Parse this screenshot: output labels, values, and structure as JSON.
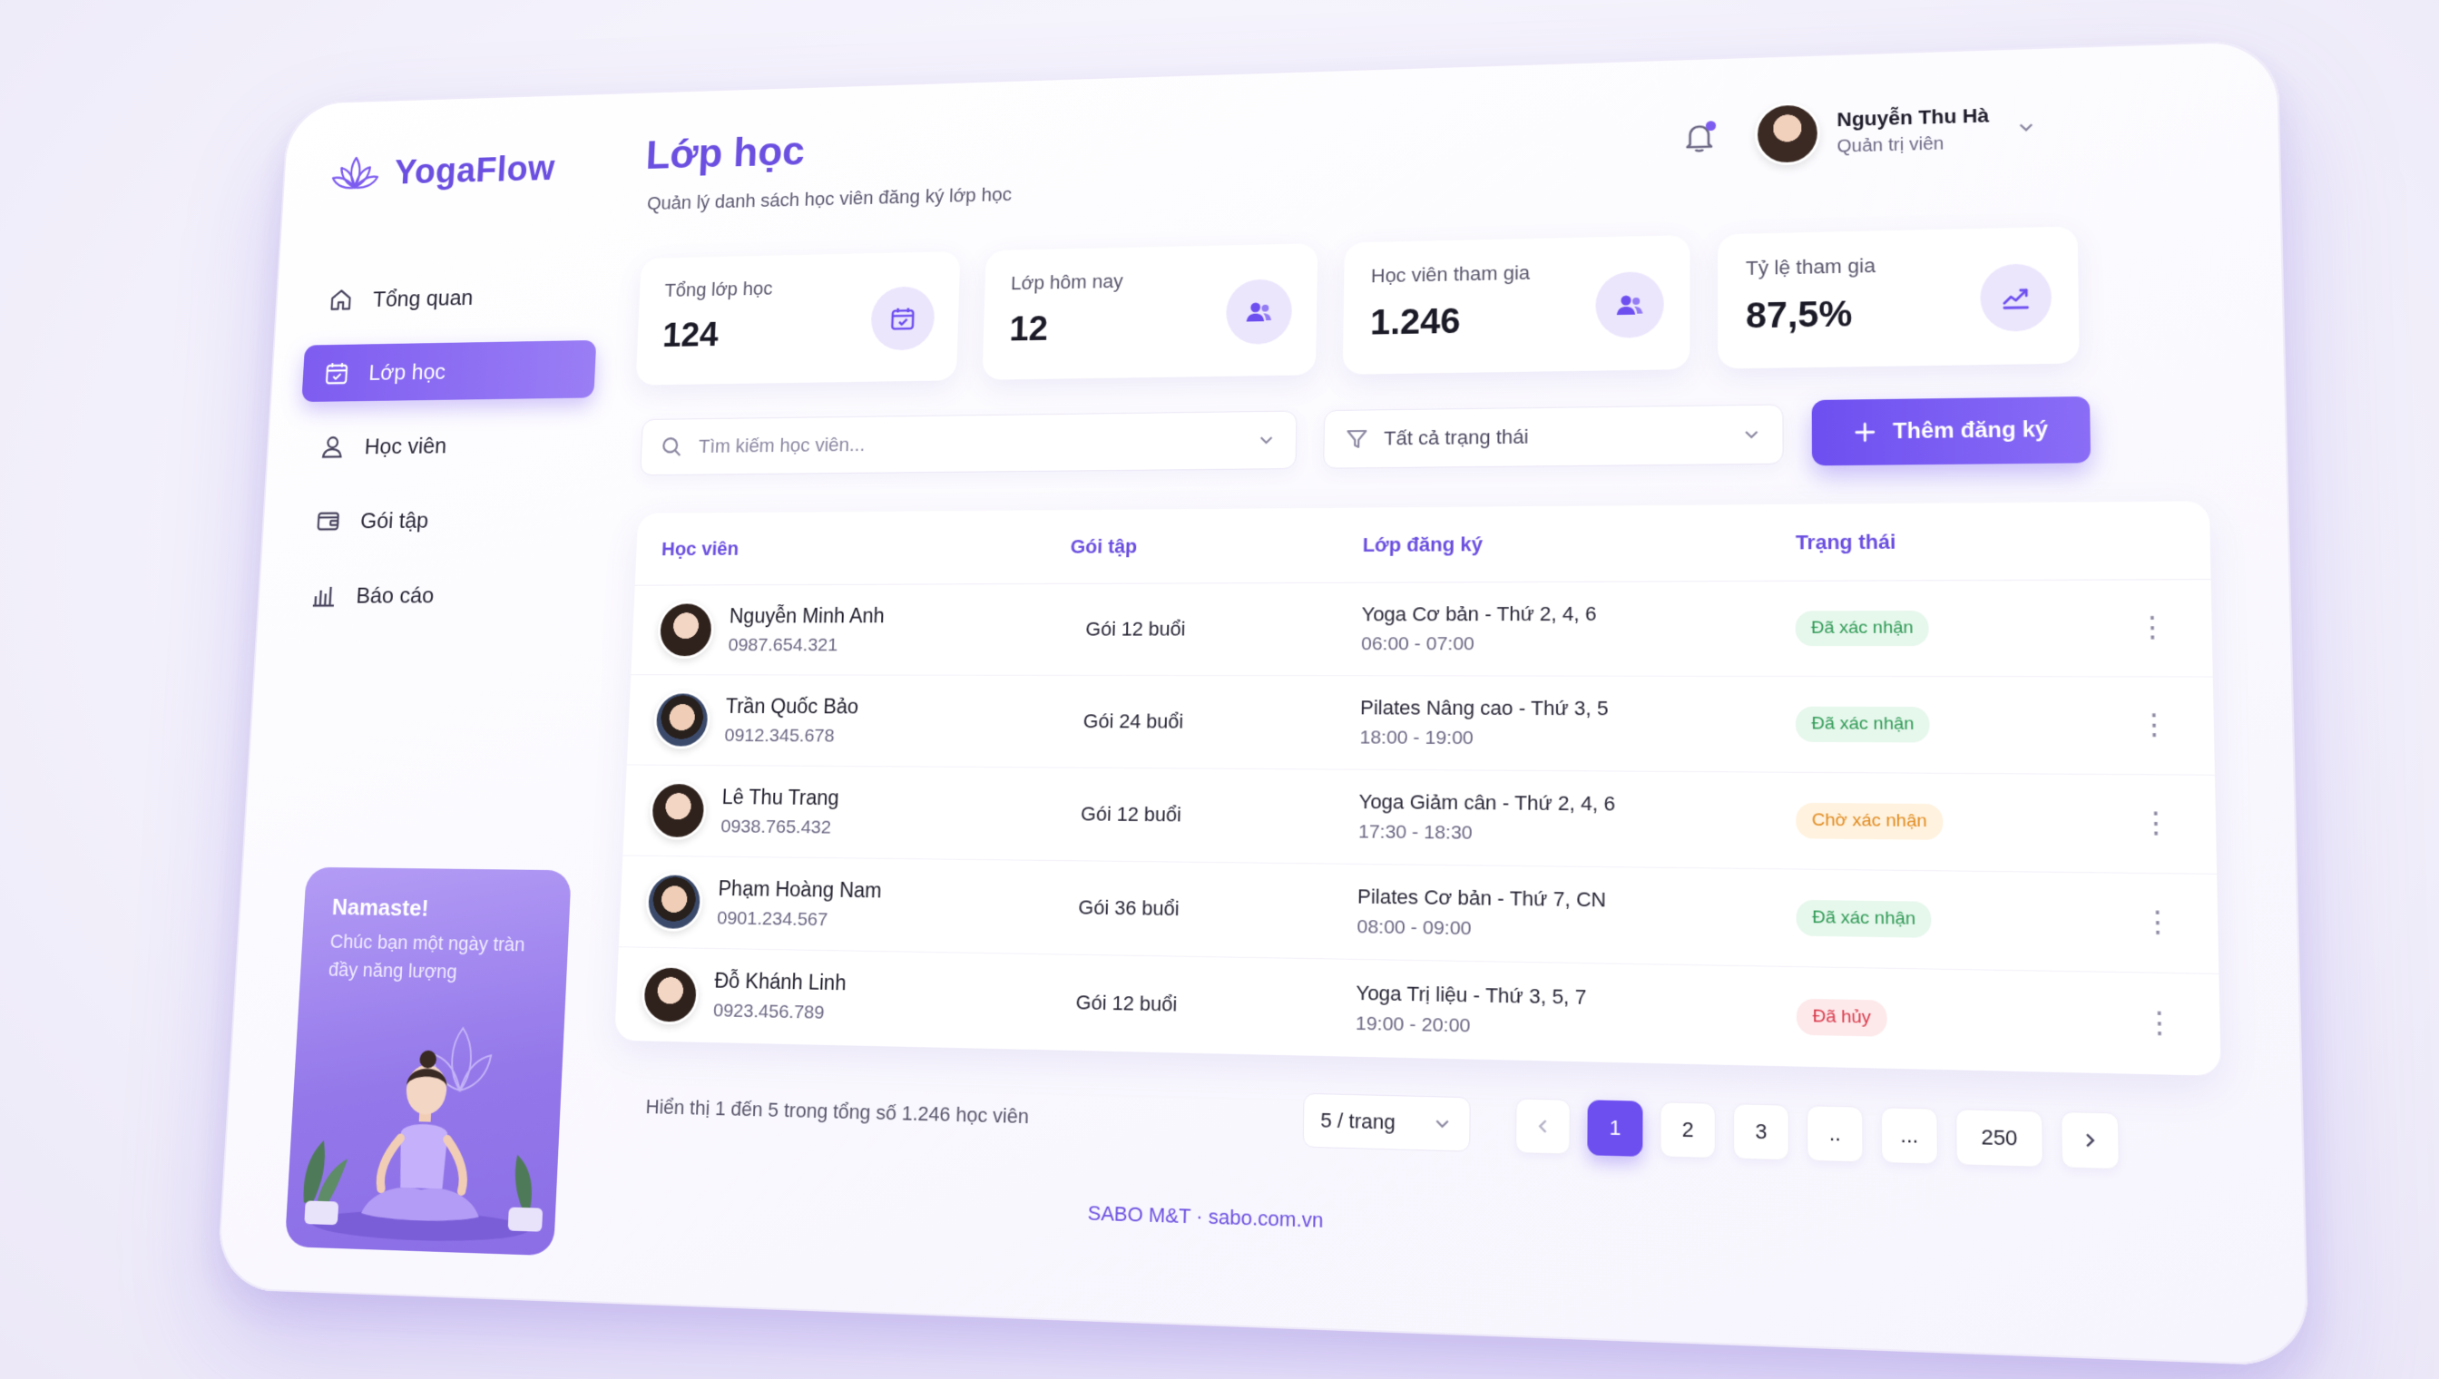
{
  "app": {
    "name": "YogaFlow"
  },
  "sidebar": {
    "items": [
      {
        "label": "Tổng quan",
        "icon": "home-icon"
      },
      {
        "label": "Lớp học",
        "icon": "calendar-icon",
        "active": true
      },
      {
        "label": "Học viên",
        "icon": "user-icon"
      },
      {
        "label": "Gói tập",
        "icon": "wallet-icon"
      },
      {
        "label": "Báo cáo",
        "icon": "bar-chart-icon"
      }
    ],
    "promo": {
      "title": "Namaste!",
      "text": "Chúc bạn một ngày tràn đầy năng lượng"
    }
  },
  "header": {
    "title": "Lớp học",
    "subtitle": "Quản lý danh sách học viên đăng ký lớp học",
    "user": {
      "name": "Nguyễn Thu Hà",
      "role": "Quản trị viên"
    }
  },
  "stats": [
    {
      "label": "Tổng lớp học",
      "value": "124",
      "icon": "calendar-icon"
    },
    {
      "label": "Lớp hôm nay",
      "value": "12",
      "icon": "users-icon"
    },
    {
      "label": "Học viên tham gia",
      "value": "1.246",
      "icon": "users-icon"
    },
    {
      "label": "Tỷ lệ tham gia",
      "value": "87,5%",
      "icon": "trend-icon"
    }
  ],
  "toolbar": {
    "search_placeholder": "Tìm kiếm học viên...",
    "filter_label": "Tất cả trạng thái",
    "add_label": "Thêm đăng ký"
  },
  "table": {
    "headers": [
      "Học viên",
      "Gói tập",
      "Lớp đăng ký",
      "Trạng thái"
    ],
    "rows": [
      {
        "name": "Nguyễn Minh Anh",
        "phone": "0987.654.321",
        "package": "Gói 12 buổi",
        "class": "Yoga Cơ bản - Thứ 2, 4, 6",
        "time": "06:00 - 07:00",
        "status": "Đã xác nhận",
        "status_type": "ok",
        "gender": "f"
      },
      {
        "name": "Trần Quốc Bảo",
        "phone": "0912.345.678",
        "package": "Gói 24 buổi",
        "class": "Pilates Nâng cao - Thứ 3, 5",
        "time": "18:00 - 19:00",
        "status": "Đã xác nhận",
        "status_type": "ok",
        "gender": "m"
      },
      {
        "name": "Lê Thu Trang",
        "phone": "0938.765.432",
        "package": "Gói 12 buổi",
        "class": "Yoga Giảm cân - Thứ 2, 4, 6",
        "time": "17:30 - 18:30",
        "status": "Chờ xác nhận",
        "status_type": "wait",
        "gender": "f"
      },
      {
        "name": "Phạm Hoàng Nam",
        "phone": "0901.234.567",
        "package": "Gói 36 buổi",
        "class": "Pilates Cơ bản - Thứ 7, CN",
        "time": "08:00 - 09:00",
        "status": "Đã xác nhận",
        "status_type": "ok",
        "gender": "m"
      },
      {
        "name": "Đỗ Khánh Linh",
        "phone": "0923.456.789",
        "package": "Gói 12 buổi",
        "class": "Yoga Trị liệu - Thứ 3, 5, 7",
        "time": "19:00 - 20:00",
        "status": "Đã hủy",
        "status_type": "cancel",
        "gender": "f"
      }
    ]
  },
  "pagination": {
    "info": "Hiển thị 1 đến 5 trong tổng số 1.246 học viên",
    "per_page": "5 / trang",
    "pages": [
      "1",
      "2",
      "3",
      "..",
      "...",
      "250"
    ],
    "current": "1"
  },
  "footer": {
    "brand": "SABO M&T · sabo.com.vn"
  },
  "colors": {
    "accent": "#6b4fe0",
    "success": "#2f9a55",
    "warning": "#e08a1e",
    "danger": "#d93a4b"
  }
}
